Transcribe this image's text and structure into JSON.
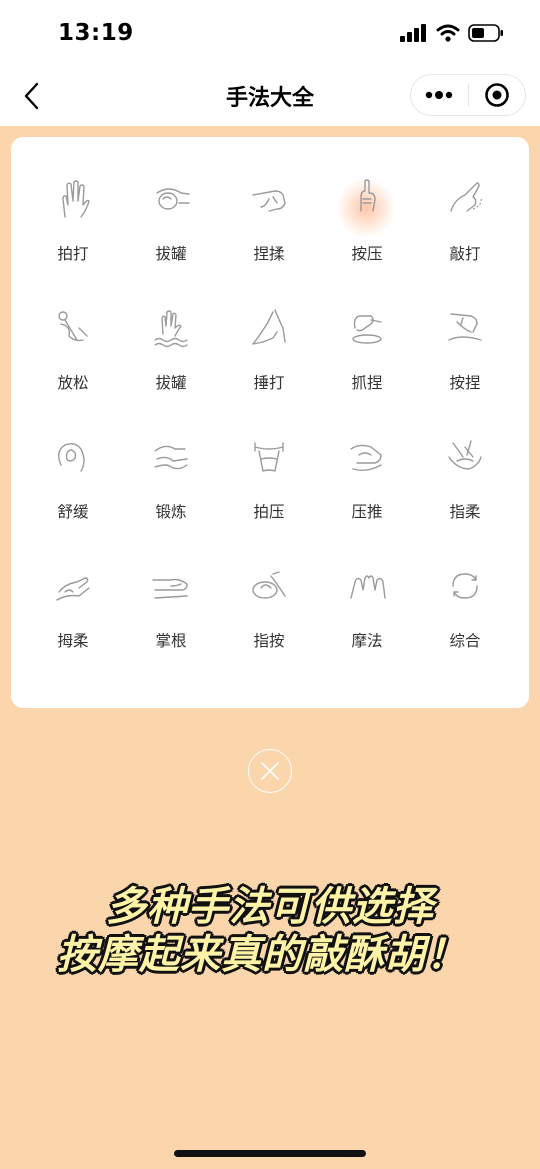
{
  "status_bar": {
    "time": "13:19"
  },
  "navbar": {
    "title": "手法大全",
    "back_icon": "chevron-left-icon",
    "more_icon": "more-dots-icon",
    "target_icon": "target-icon"
  },
  "techniques": [
    {
      "label": "拍打",
      "icon": "palm-hand-icon"
    },
    {
      "label": "拔罐",
      "icon": "cupping-hand-icon"
    },
    {
      "label": "捏揉",
      "icon": "pinch-hand-icon"
    },
    {
      "label": "按压",
      "icon": "thumb-press-icon",
      "selected": true
    },
    {
      "label": "敲打",
      "icon": "tap-hand-icon"
    },
    {
      "label": "放松",
      "icon": "massage-tool-icon"
    },
    {
      "label": "拔罐",
      "icon": "wave-hand-icon"
    },
    {
      "label": "捶打",
      "icon": "hammer-hand-icon"
    },
    {
      "label": "抓捏",
      "icon": "grab-hand-icon"
    },
    {
      "label": "按捏",
      "icon": "press-pinch-icon"
    },
    {
      "label": "舒缓",
      "icon": "soothe-icon"
    },
    {
      "label": "锻炼",
      "icon": "wave-lines-icon"
    },
    {
      "label": "拍压",
      "icon": "waist-icon"
    },
    {
      "label": "压推",
      "icon": "push-hand-icon"
    },
    {
      "label": "指柔",
      "icon": "finger-soft-icon"
    },
    {
      "label": "拇柔",
      "icon": "thumb-soft-icon"
    },
    {
      "label": "掌根",
      "icon": "palm-root-icon"
    },
    {
      "label": "指按",
      "icon": "finger-press-icon"
    },
    {
      "label": "摩法",
      "icon": "rub-hands-icon"
    },
    {
      "label": "综合",
      "icon": "cycle-arrows-icon"
    }
  ],
  "close_icon": "close-circle-icon",
  "promo": {
    "line1": "多种手法可供选择",
    "line2": "按摩起来真的敲酥胡！"
  },
  "colors": {
    "background": "#fbd6ad",
    "panel": "#ffffff",
    "icon_stroke": "#9a9a9a",
    "promo_fill": "#fff3a8",
    "selected_glow": "#ff9664"
  }
}
